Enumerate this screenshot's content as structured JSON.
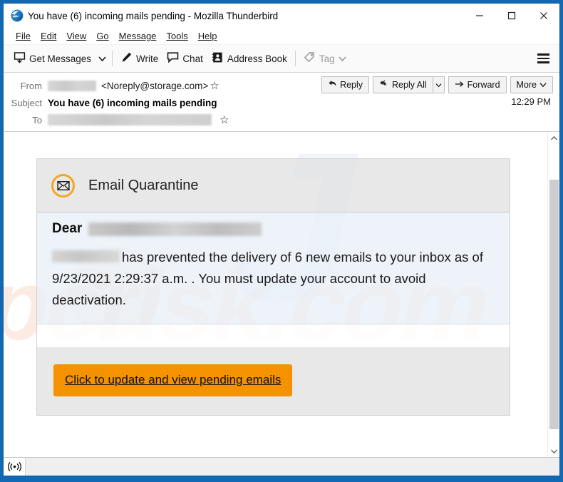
{
  "window": {
    "title": "You have (6) incoming mails pending - Mozilla Thunderbird",
    "app_icon": "thunderbird-icon",
    "controls": {
      "minimize": "minimize-icon",
      "maximize": "maximize-icon",
      "close": "close-icon"
    }
  },
  "menubar": {
    "items": [
      {
        "label": "File"
      },
      {
        "label": "Edit"
      },
      {
        "label": "View"
      },
      {
        "label": "Go"
      },
      {
        "label": "Message"
      },
      {
        "label": "Tools"
      },
      {
        "label": "Help"
      }
    ]
  },
  "toolbar": {
    "get_messages": "Get Messages",
    "write": "Write",
    "chat": "Chat",
    "address_book": "Address Book",
    "tag": "Tag",
    "menu_icon": "hamburger-icon"
  },
  "message_header": {
    "from_label": "From",
    "from_name_redacted": "",
    "from_address": "<Noreply@storage.com>",
    "subject_label": "Subject",
    "subject": "You have (6) incoming mails pending",
    "to_label": "To",
    "to_redacted": "",
    "time": "12:29 PM",
    "actions": {
      "reply": "Reply",
      "reply_all": "Reply All",
      "forward": "Forward",
      "more": "More"
    }
  },
  "email_body": {
    "card_title": "Email Quarantine",
    "card_icon": "quarantine-envelope-icon",
    "greeting": "Dear",
    "greeting_name_redacted": "",
    "paragraph_sender_redacted": "",
    "paragraph": "has prevented the delivery of 6 new emails to your inbox as of 9/23/2021 2:29:37 a.m. . You must update your account to avoid deactivation.",
    "cta_label": "Click to update  and view pending emails",
    "watermark_text": "pcrisk.com"
  },
  "statusbar": {
    "icon": "connection-icon",
    "text": ""
  },
  "colors": {
    "window_frame": "#1268b3",
    "accent_orange": "#f59200",
    "icon_ring": "#f5a623",
    "body_panel": "#e9f0f8",
    "card_header": "#e2e2e2"
  },
  "scrollbar": {
    "up_arrow": "chevron-up-icon",
    "down_arrow": "chevron-down-icon"
  }
}
